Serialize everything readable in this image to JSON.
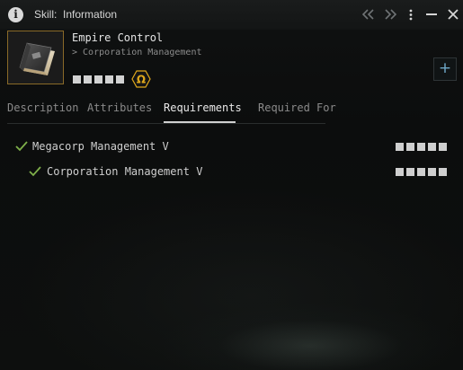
{
  "window": {
    "title_prefix": "Skill:",
    "title": "Information"
  },
  "titlebar": {
    "icons": [
      "info-icon",
      "back-icon",
      "forward-icon",
      "menu-icon",
      "minimize-icon",
      "close-icon"
    ]
  },
  "skill": {
    "name": "Empire Control",
    "group": "> Corporation Management",
    "trained_level": 0,
    "max_level": 5,
    "icon": "skillbook-icon",
    "badge_icon": "omega-icon",
    "badge_glyph": "Ω",
    "badge_color": "#e0a81c",
    "add_glyph": "+"
  },
  "tabs": [
    {
      "label": "Description",
      "active": false
    },
    {
      "label": "Attributes",
      "active": false
    },
    {
      "label": "Requirements",
      "active": true
    },
    {
      "label": "Required For",
      "active": false
    }
  ],
  "requirements": [
    {
      "name": "Megacorp Management",
      "level": "V",
      "met": true,
      "levels_shown": 5
    },
    {
      "name": "Corporation Management",
      "level": "V",
      "met": true,
      "levels_shown": 5
    }
  ],
  "colors": {
    "check": "#7fb04a",
    "accent_plus": "#6ea8c8",
    "icon_frame": "#8a6a28"
  }
}
